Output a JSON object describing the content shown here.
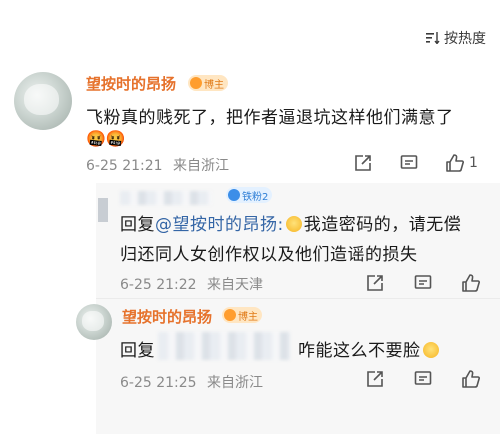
{
  "sort": {
    "label": "按热度"
  },
  "comments": [
    {
      "username": "望按时的昂扬",
      "badge": "博主",
      "text": "飞粉真的贱死了，把作者逼退坑这样他们满意了",
      "emoji": "🤬🤬",
      "date": "6-25 21:21",
      "location": "来自浙江",
      "likes": "1"
    }
  ],
  "replies": [
    {
      "badge": "铁粉2",
      "prefix": "回复",
      "mention": "@望按时的昂扬:",
      "text_line1": "我造密码的，请无偿",
      "text_line2": "归还同人女创作权以及他们造谣的损失",
      "date": "6-25 21:22",
      "location": "来自天津"
    },
    {
      "username": "望按时的昂扬",
      "badge": "博主",
      "prefix": "回复",
      "text": "咋能这么不要脸",
      "date": "6-25 21:25",
      "location": "来自浙江"
    }
  ],
  "icons": [
    "sort-icon",
    "share-icon",
    "comment-icon",
    "like-icon"
  ],
  "colors": {
    "username": "#e6722c",
    "mention": "#3566a6",
    "meta": "#8a8a8a",
    "badge_bg": "#ffe6c2"
  }
}
